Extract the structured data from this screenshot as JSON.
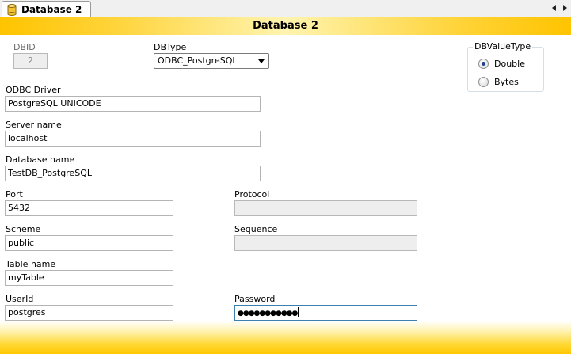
{
  "tab": {
    "label": "Database 2",
    "icon": "database-icon"
  },
  "nav": {
    "left_icon": "scroll-left-icon",
    "right_icon": "scroll-right-icon"
  },
  "header": {
    "title": "Database 2"
  },
  "form": {
    "dbid": {
      "label": "DBID",
      "value": "2"
    },
    "dbtype": {
      "label": "DBType",
      "value": "ODBC_PostgreSQL"
    },
    "dbvaluetype": {
      "label": "DBValueType",
      "options": [
        {
          "label": "Double",
          "selected": true
        },
        {
          "label": "Bytes",
          "selected": false
        }
      ]
    },
    "odbc_driver": {
      "label": "ODBC Driver",
      "value": "PostgreSQL UNICODE"
    },
    "server_name": {
      "label": "Server name",
      "value": "localhost"
    },
    "database_name": {
      "label": "Database name",
      "value": "TestDB_PostgreSQL"
    },
    "port": {
      "label": "Port",
      "value": "5432"
    },
    "protocol": {
      "label": "Protocol",
      "value": ""
    },
    "scheme": {
      "label": "Scheme",
      "value": "public"
    },
    "sequence": {
      "label": "Sequence",
      "value": ""
    },
    "table_name": {
      "label": "Table name",
      "value": "myTable"
    },
    "userid": {
      "label": "UserId",
      "value": "postgres"
    },
    "password": {
      "label": "Password",
      "value": "●●●●●●●●●●●"
    }
  },
  "colors": {
    "accent_yellow": "#ffc400",
    "focus_border": "#3c7fb1",
    "radio_dot": "#1e3f8a"
  }
}
